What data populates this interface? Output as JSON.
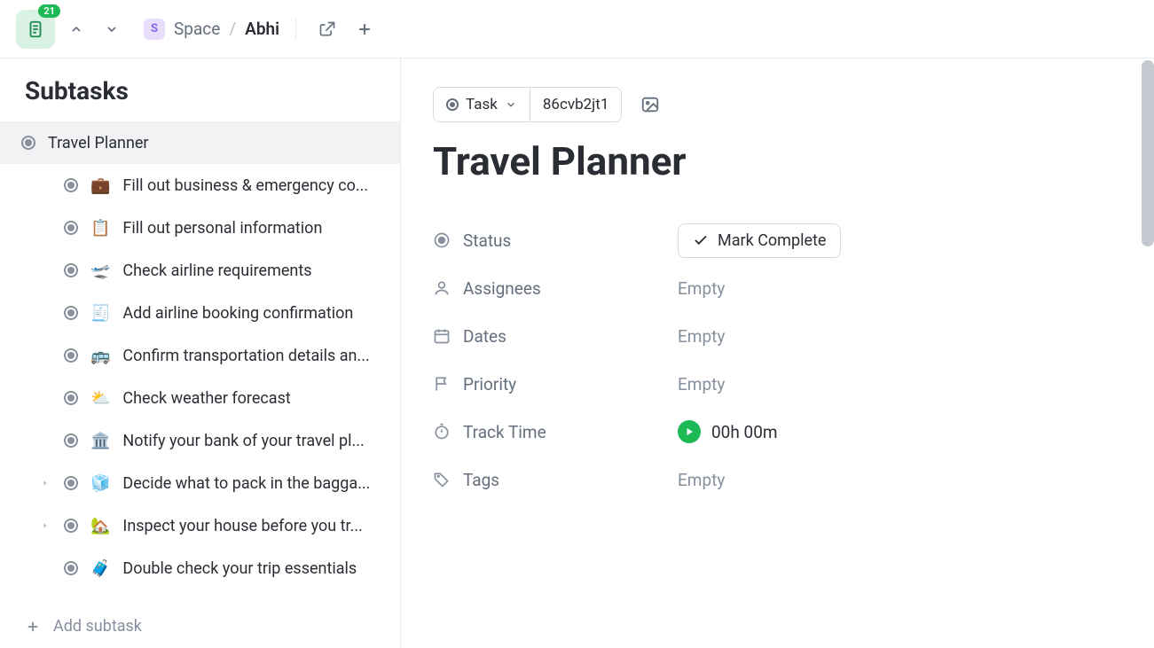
{
  "header": {
    "badge_count": "21",
    "breadcrumbs": {
      "space_label": "Space",
      "space_initial": "S",
      "current": "Abhi"
    }
  },
  "sidebar": {
    "title": "Subtasks",
    "add_label": "Add subtask",
    "items": [
      {
        "label": "Travel Planner",
        "emoji": "",
        "child": false,
        "selected": true,
        "expandable": false
      },
      {
        "label": "Fill out business & emergency co...",
        "emoji": "💼",
        "child": true,
        "selected": false,
        "expandable": false
      },
      {
        "label": "Fill out personal information",
        "emoji": "📋",
        "child": true,
        "selected": false,
        "expandable": false
      },
      {
        "label": "Check airline requirements",
        "emoji": "🛫",
        "child": true,
        "selected": false,
        "expandable": false
      },
      {
        "label": "Add airline booking confirmation",
        "emoji": "🧾",
        "child": true,
        "selected": false,
        "expandable": false
      },
      {
        "label": "Confirm transportation details an...",
        "emoji": "🚌",
        "child": true,
        "selected": false,
        "expandable": false
      },
      {
        "label": "Check weather forecast",
        "emoji": "⛅",
        "child": true,
        "selected": false,
        "expandable": false
      },
      {
        "label": "Notify your bank of your travel pl...",
        "emoji": "🏛️",
        "child": true,
        "selected": false,
        "expandable": false
      },
      {
        "label": "Decide what to pack in the bagga...",
        "emoji": "🧊",
        "child": true,
        "selected": false,
        "expandable": true
      },
      {
        "label": "Inspect your house before you tr...",
        "emoji": "🏡",
        "child": true,
        "selected": false,
        "expandable": true
      },
      {
        "label": "Double check your trip essentials",
        "emoji": "🧳",
        "child": true,
        "selected": false,
        "expandable": false
      }
    ]
  },
  "detail": {
    "type_label": "Task",
    "task_id": "86cvb2jt1",
    "title": "Travel Planner",
    "fields": {
      "status_label": "Status",
      "mark_complete": "Mark Complete",
      "assignees_label": "Assignees",
      "assignees_value": "Empty",
      "dates_label": "Dates",
      "dates_value": "Empty",
      "priority_label": "Priority",
      "priority_value": "Empty",
      "track_time_label": "Track Time",
      "track_time_value": "00h 00m",
      "tags_label": "Tags",
      "tags_value": "Empty"
    }
  }
}
